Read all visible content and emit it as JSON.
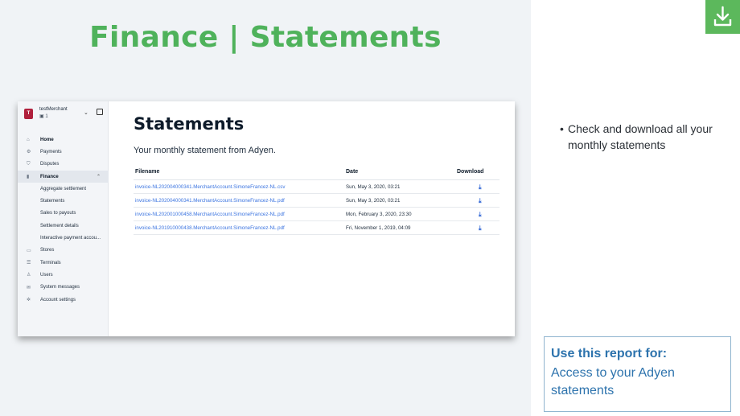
{
  "slide": {
    "title": "Finance | Statements",
    "bullet": "Check  and download all your monthly statements",
    "note_heading": "Use this report for:",
    "note_body": "Access to your Adyen statements",
    "accent_color": "#4fb25b",
    "note_color": "#2d73ad",
    "badge_icon": "download-icon"
  },
  "account": {
    "avatar": "T",
    "name": "testMerchant",
    "count": "1"
  },
  "sidebar": {
    "items": [
      {
        "icon": "home-icon",
        "glyph": "⌂",
        "label": "Home",
        "bold": true
      },
      {
        "icon": "payments-icon",
        "glyph": "⚙",
        "label": "Payments"
      },
      {
        "icon": "disputes-icon",
        "glyph": "⛉",
        "label": "Disputes"
      },
      {
        "icon": "finance-icon",
        "glyph": "▮",
        "label": "Finance",
        "bold": true,
        "active": true,
        "expanded": true
      },
      {
        "label": "Aggregate settlement",
        "sub": true
      },
      {
        "label": "Statements",
        "sub": true
      },
      {
        "label": "Sales to payouts",
        "sub": true
      },
      {
        "label": "Settlement details",
        "sub": true
      },
      {
        "label": "Interactive payment accou...",
        "sub": true
      },
      {
        "icon": "stores-icon",
        "glyph": "▭",
        "label": "Stores"
      },
      {
        "icon": "terminals-icon",
        "glyph": "☰",
        "label": "Terminals"
      },
      {
        "icon": "users-icon",
        "glyph": "♙",
        "label": "Users"
      },
      {
        "icon": "messages-icon",
        "glyph": "✉",
        "label": "System messages"
      },
      {
        "icon": "settings-icon",
        "glyph": "✲",
        "label": "Account settings"
      }
    ]
  },
  "main": {
    "title": "Statements",
    "description": "Your monthly statement from Adyen.",
    "columns": {
      "file": "Filename",
      "date": "Date",
      "download": "Download"
    },
    "rows": [
      {
        "file": "invoice-NL202004000341.MerchantAccount.SimoneFrancez-NL.csv",
        "date": "Sun, May 3, 2020, 03:21"
      },
      {
        "file": "invoice-NL202004000341.MerchantAccount.SimoneFrancez-NL.pdf",
        "date": "Sun, May 3, 2020, 03:21"
      },
      {
        "file": "invoice-NL202001000458.MerchantAccount.SimoneFrancez-NL.pdf",
        "date": "Mon, February 3, 2020, 23:30"
      },
      {
        "file": "invoice-NL201910000438.MerchantAccount.SimoneFrancez-NL.pdf",
        "date": "Fri, November 1, 2019, 04:09"
      }
    ]
  }
}
